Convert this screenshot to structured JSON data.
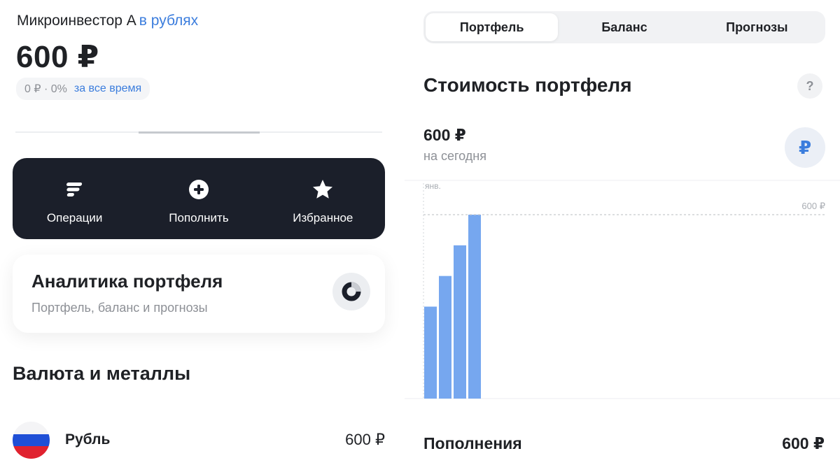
{
  "account": {
    "name": "Микроинвестор А",
    "currency_label": "в рублях",
    "total_value": "600 ₽",
    "change": "0 ₽ · 0%",
    "period_label": "за все время"
  },
  "actions": [
    {
      "label": "Операции",
      "icon": "operations-icon"
    },
    {
      "label": "Пополнить",
      "icon": "plus-circle-icon"
    },
    {
      "label": "Избранное",
      "icon": "star-icon"
    }
  ],
  "analytics_card": {
    "title": "Аналитика портфеля",
    "subtitle": "Портфель, баланс и прогнозы",
    "icon": "donut-chart-icon"
  },
  "currencies": {
    "section_title": "Валюта и металлы",
    "items": [
      {
        "name": "Рубль",
        "amount": "600 ₽",
        "icon": "russia-flag-icon"
      }
    ]
  },
  "tabs": [
    {
      "label": "Портфель",
      "active": true
    },
    {
      "label": "Баланс",
      "active": false
    },
    {
      "label": "Прогнозы",
      "active": false
    }
  ],
  "portfolio_value": {
    "title": "Стоимость портфеля",
    "help_label": "?",
    "current_value": "600 ₽",
    "current_caption": "на сегодня",
    "currency_button": "₽"
  },
  "chart_data": {
    "type": "bar",
    "x_tick_labels": [
      "янв."
    ],
    "reference_line": {
      "value": 600,
      "label": "600 ₽"
    },
    "ylim": [
      0,
      600
    ],
    "values": [
      300,
      400,
      500,
      600
    ],
    "bar_color": "#76a7ef",
    "grid": false
  },
  "deposits": {
    "label": "Пополнения",
    "amount": "600 ₽"
  },
  "colors": {
    "accent": "#3b7ddd",
    "dark_card": "#1b1f2a",
    "bar": "#76a7ef"
  }
}
